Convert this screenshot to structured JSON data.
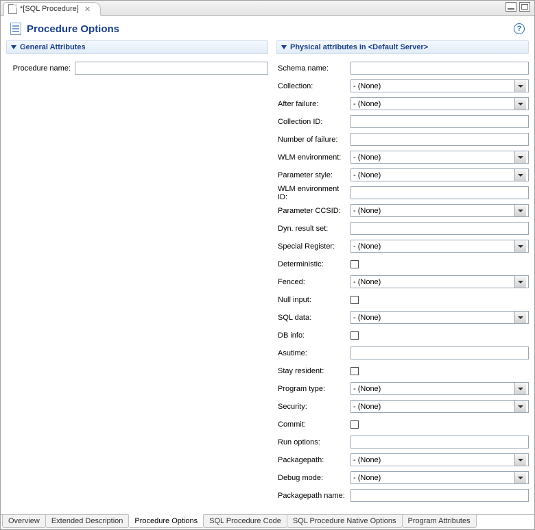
{
  "editor_tab": {
    "label": "*[SQL Procedure]"
  },
  "title": "Procedure Options",
  "sections": {
    "general": {
      "header": "General Attributes",
      "procedure_name_label": "Procedure name:",
      "procedure_name_value": ""
    },
    "physical": {
      "header": "Physical attributes in <Default Server>",
      "fields": [
        {
          "label": "Schema name:",
          "type": "text",
          "value": ""
        },
        {
          "label": "Collection:",
          "type": "select",
          "value": "- (None)"
        },
        {
          "label": "After failure:",
          "type": "select",
          "value": "- (None)"
        },
        {
          "label": "Collection ID:",
          "type": "text",
          "value": ""
        },
        {
          "label": "Number of failure:",
          "type": "text",
          "value": ""
        },
        {
          "label": "WLM environment:",
          "type": "select",
          "value": "- (None)"
        },
        {
          "label": "Parameter style:",
          "type": "select",
          "value": "- (None)"
        },
        {
          "label": "WLM environment ID:",
          "type": "text",
          "value": ""
        },
        {
          "label": "Parameter CCSID:",
          "type": "select",
          "value": "- (None)"
        },
        {
          "label": "Dyn. result set:",
          "type": "text",
          "value": ""
        },
        {
          "label": "Special Register:",
          "type": "select",
          "value": "- (None)"
        },
        {
          "label": "Deterministic:",
          "type": "check",
          "value": false
        },
        {
          "label": "Fenced:",
          "type": "select",
          "value": "- (None)"
        },
        {
          "label": "Null input:",
          "type": "check",
          "value": false
        },
        {
          "label": "SQL data:",
          "type": "select",
          "value": "- (None)"
        },
        {
          "label": "DB info:",
          "type": "check",
          "value": false
        },
        {
          "label": "Asutime:",
          "type": "text",
          "value": ""
        },
        {
          "label": "Stay resident:",
          "type": "check",
          "value": false
        },
        {
          "label": "Program type:",
          "type": "select",
          "value": "- (None)"
        },
        {
          "label": "Security:",
          "type": "select",
          "value": "- (None)"
        },
        {
          "label": "Commit:",
          "type": "check",
          "value": false
        },
        {
          "label": "Run options:",
          "type": "text",
          "value": ""
        },
        {
          "label": "Packagepath:",
          "type": "select",
          "value": "- (None)"
        },
        {
          "label": "Debug mode:",
          "type": "select",
          "value": "- (None)"
        },
        {
          "label": "Packagepath name:",
          "type": "text",
          "value": ""
        }
      ]
    }
  },
  "bottom_tabs": [
    {
      "label": "Overview",
      "active": false
    },
    {
      "label": "Extended Description",
      "active": false
    },
    {
      "label": "Procedure Options",
      "active": true
    },
    {
      "label": "SQL Procedure Code",
      "active": false
    },
    {
      "label": "SQL Procedure Native Options",
      "active": false
    },
    {
      "label": "Program Attributes",
      "active": false
    }
  ]
}
